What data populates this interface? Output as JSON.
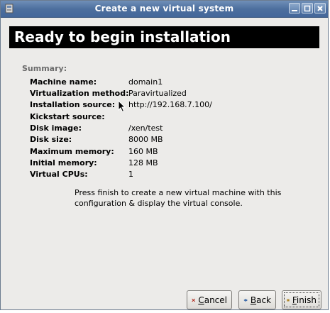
{
  "window": {
    "title": "Create a new virtual system"
  },
  "header": {
    "title": "Ready to begin installation"
  },
  "summary": {
    "label": "Summary:",
    "rows": [
      {
        "label": "Machine name:",
        "value": "domain1"
      },
      {
        "label": "Virtualization method:",
        "value": "Paravirtualized"
      },
      {
        "label": "Installation source:",
        "value": "http://192.168.7.100/"
      },
      {
        "label": "Kickstart source:",
        "value": ""
      },
      {
        "label": "Disk image:",
        "value": "/xen/test"
      },
      {
        "label": "Disk size:",
        "value": "8000 MB"
      },
      {
        "label": "Maximum memory:",
        "value": "160 MB"
      },
      {
        "label": "Initial memory:",
        "value": "128 MB"
      },
      {
        "label": "Virtual CPUs:",
        "value": "1"
      }
    ]
  },
  "info": {
    "text": "Press finish to create a new virtual machine with this configuration & display the virtual console."
  },
  "buttons": {
    "cancel": "Cancel",
    "back": "Back",
    "finish": "Finish"
  },
  "icons": {
    "app": "app-icon",
    "minimize": "minimize-icon",
    "maximize": "maximize-icon",
    "close": "close-icon",
    "cancel": "cancel-x-icon",
    "back": "back-arrow-icon",
    "finish": "finish-icon"
  }
}
